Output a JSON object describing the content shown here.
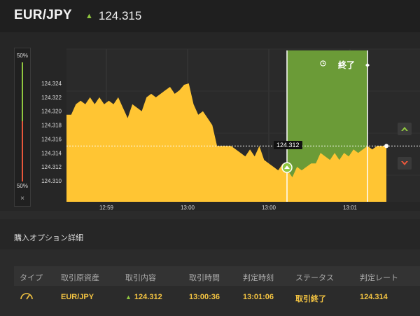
{
  "header": {
    "pair": "EUR/JPY",
    "price": "124.315",
    "direction_icon": "up-arrow-icon"
  },
  "sidebar": {
    "top_pct": "50%",
    "bottom_pct": "50%",
    "close_label": "×",
    "top_color": "#8fc63f",
    "bottom_color": "#e8573b"
  },
  "chart": {
    "end_label": "終了",
    "current_tag": "124.312",
    "area_color": "#ffc533",
    "window_color": "#6b9b37"
  },
  "chart_data": {
    "type": "area",
    "y_ticks": [
      "124.324",
      "124.322",
      "124.320",
      "124.318",
      "124.316",
      "124.314",
      "124.312",
      "124.310"
    ],
    "x_ticks": [
      "12:59",
      "13:00",
      "13:00",
      "13:01"
    ],
    "ylim": [
      124.308,
      124.326
    ],
    "current_price": 124.315,
    "entry_price": 124.312,
    "series": [
      {
        "values": [
          124.3195,
          124.3195,
          124.321,
          124.3215,
          124.321,
          124.322,
          124.321,
          124.322,
          124.321,
          124.3215,
          124.321,
          124.322,
          124.3205,
          124.319,
          124.321,
          124.3205,
          124.32,
          124.322,
          124.3225,
          124.322,
          124.3225,
          124.323,
          124.3235,
          124.3225,
          124.323,
          124.3238,
          124.324,
          124.321,
          124.3195,
          124.32,
          124.319,
          124.318,
          124.315,
          124.315,
          124.315,
          124.315,
          124.3145,
          124.314,
          124.3135,
          124.3145,
          124.3135,
          124.315,
          124.313,
          124.3125,
          124.312,
          124.3115,
          124.3125,
          124.3115,
          124.3105,
          124.312,
          124.3115,
          124.312,
          124.3125,
          124.3125,
          124.314,
          124.3135,
          124.313,
          124.314,
          124.313,
          124.314,
          124.3135,
          124.3145,
          124.314,
          124.3145,
          124.315,
          124.3145,
          124.315,
          124.315,
          124.315
        ]
      }
    ]
  },
  "section": {
    "title": "購入オプション詳細"
  },
  "table": {
    "headers": [
      "タイプ",
      "取引原資産",
      "取引内容",
      "取引時間",
      "判定時刻",
      "ステータス",
      "判定レート"
    ],
    "row": {
      "type_icon": "gauge-icon",
      "asset": "EUR/JPY",
      "content": "124.312",
      "content_icon": "up-arrow-icon",
      "trade_time": "13:00:36",
      "judge_time": "13:01:06",
      "status": "取引終了",
      "rate": "124.314"
    }
  }
}
